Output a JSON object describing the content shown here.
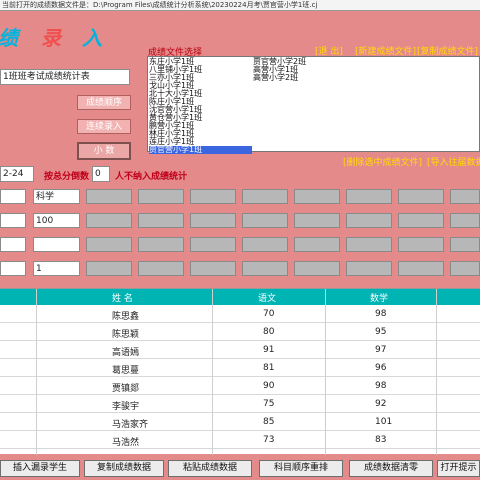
{
  "window": {
    "title": "当前打开的成绩数据文件是：D:\\Program Files\\成绩统计分析系统\\20230224月考\\贾官营小学1班.cj"
  },
  "logo": {
    "text_blue": "绩",
    "text_red": "录",
    "text_blue2": "入"
  },
  "table_title": "1班班考试成绩统计表",
  "buttons": {
    "sort": "成绩顺序",
    "enter": "连续录入",
    "decimal": "小 数",
    "exit": "[退 出]",
    "new_file": "[新建成绩文件]",
    "copy_file": "[复制成绩文件]",
    "delete_file": "[删除选中成绩文件]",
    "import": "[导入往届数据]"
  },
  "file_list": {
    "label": "成绩文件选择",
    "col1": [
      "东庄小学1班",
      "八里铺小学1班",
      "三亦小学1班",
      "戈山小学1班",
      "北十大小学1班",
      "陈庄小学1班",
      "沈官营小学1班",
      "黄仓营小学1班",
      "鹏营小学1班",
      "林庄小学1班",
      "莲庄小学1班",
      "贾官营小学1班"
    ],
    "col2": [
      "贾官营小学2班",
      "高营小学1班",
      "高营小学2班"
    ],
    "selected_index": 11
  },
  "stats_row": {
    "date_value": "2-24",
    "label1": "按总分倒数",
    "count_value": "0",
    "label2": "人不纳入成绩统计"
  },
  "subject_rows": {
    "subject": "科学",
    "full_score": "100",
    "weight": "1"
  },
  "grid": {
    "headers": {
      "name": "姓 名",
      "chinese": "语文",
      "math": "数学"
    },
    "rows": [
      {
        "name": "陈思鑫",
        "chinese": "70",
        "math": "98"
      },
      {
        "name": "陈思颖",
        "chinese": "80",
        "math": "95"
      },
      {
        "name": "高语嫣",
        "chinese": "91",
        "math": "97"
      },
      {
        "name": "葛思蔓",
        "chinese": "81",
        "math": "96"
      },
      {
        "name": "贾镇郯",
        "chinese": "90",
        "math": "98"
      },
      {
        "name": "李骏宇",
        "chinese": "75",
        "math": "92"
      },
      {
        "name": "马浩家齐",
        "chinese": "85",
        "math": "101"
      },
      {
        "name": "马浩然",
        "chinese": "73",
        "math": "83"
      }
    ]
  },
  "bottom_buttons": [
    "插入漏录学生",
    "复制成绩数据",
    "粘贴成绩数据",
    "科目顺序重排",
    "成绩数据清零",
    "打开提示"
  ]
}
